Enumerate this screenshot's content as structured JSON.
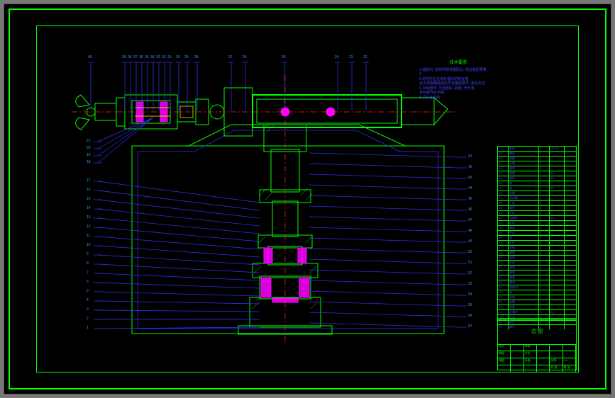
{
  "notes": {
    "title": "技术要求",
    "lines": [
      "1.装配时, 请参照部件图配合, 保证装配质量",
      "2.",
      "3.零件应经过热处理及防锈处理",
      "  加工表面粗糙度应符合图纸要求, 各处光洁",
      "4. 转动部件 灵活自如, 紧固, 无卡滞",
      "  手动操作应平稳,",
      "5.试车合格后",
      ""
    ]
  },
  "top_balloons": [
    "40",
    "39",
    "38",
    "37",
    "36",
    "35",
    "34",
    "33",
    "32",
    "31",
    "30",
    "29",
    "28",
    "",
    "27",
    "26",
    "",
    "25",
    "",
    "24",
    "23",
    "22"
  ],
  "left_balloons_upper": [
    "21",
    "20",
    "19",
    "18"
  ],
  "left_balloons_lower": [
    "17",
    "16",
    "15",
    "14",
    "13",
    "12",
    "11",
    "10",
    "9",
    "8",
    "7",
    "6",
    "5",
    "4",
    "3",
    "2",
    "1"
  ],
  "right_balloons": [
    "41",
    "42",
    "43",
    "44",
    "45",
    "46",
    "47",
    "48",
    "49",
    "50",
    "51",
    "52",
    "53",
    "54",
    "55",
    "56",
    "57"
  ],
  "bom": [
    {
      "no": "57",
      "name": "底座",
      "qty": "1",
      "mat": "HT200",
      "note": ""
    },
    {
      "no": "56",
      "name": "螺栓",
      "qty": "4",
      "mat": "",
      "note": ""
    },
    {
      "no": "55",
      "name": "垫圈",
      "qty": "4",
      "mat": "",
      "note": ""
    },
    {
      "no": "54",
      "name": "下盖",
      "qty": "1",
      "mat": "",
      "note": ""
    },
    {
      "no": "53",
      "name": "轴承",
      "qty": "2",
      "mat": "",
      "note": ""
    },
    {
      "no": "52",
      "name": "套筒",
      "qty": "1",
      "mat": "45",
      "note": ""
    },
    {
      "no": "51",
      "name": "齿轮",
      "qty": "1",
      "mat": "45",
      "note": ""
    },
    {
      "no": "50",
      "name": "键",
      "qty": "1",
      "mat": "",
      "note": ""
    },
    {
      "no": "49",
      "name": "轴",
      "qty": "1",
      "mat": "45",
      "note": ""
    },
    {
      "no": "48",
      "name": "挡圈",
      "qty": "1",
      "mat": "",
      "note": ""
    },
    {
      "no": "47",
      "name": "密封圈",
      "qty": "2",
      "mat": "",
      "note": ""
    },
    {
      "no": "46",
      "name": "上盖",
      "qty": "1",
      "mat": "",
      "note": ""
    },
    {
      "no": "45",
      "name": "螺钉",
      "qty": "6",
      "mat": "",
      "note": ""
    },
    {
      "no": "44",
      "name": "立柱",
      "qty": "1",
      "mat": "",
      "note": ""
    },
    {
      "no": "43",
      "name": "活塞杆",
      "qty": "1",
      "mat": "45",
      "note": ""
    },
    {
      "no": "42",
      "name": "缸体",
      "qty": "1",
      "mat": "",
      "note": ""
    },
    {
      "no": "41",
      "name": "端盖",
      "qty": "1",
      "mat": "",
      "note": ""
    },
    {
      "no": "40",
      "name": "手爪",
      "qty": "1",
      "mat": "",
      "note": ""
    },
    {
      "no": "39",
      "name": "销",
      "qty": "2",
      "mat": "",
      "note": ""
    },
    {
      "no": "38",
      "name": "连杆",
      "qty": "2",
      "mat": "",
      "note": ""
    },
    {
      "no": "37",
      "name": "夹板",
      "qty": "2",
      "mat": "",
      "note": ""
    },
    {
      "no": "36",
      "name": "弹簧",
      "qty": "1",
      "mat": "",
      "note": ""
    },
    {
      "no": "35",
      "name": "推杆",
      "qty": "1",
      "mat": "",
      "note": ""
    },
    {
      "no": "34",
      "name": "外壳",
      "qty": "1",
      "mat": "",
      "note": ""
    },
    {
      "no": "33",
      "name": "轴承",
      "qty": "2",
      "mat": "",
      "note": ""
    },
    {
      "no": "32",
      "name": "隔套",
      "qty": "1",
      "mat": "",
      "note": ""
    },
    {
      "no": "31",
      "name": "端盖",
      "qty": "1",
      "mat": "",
      "note": ""
    },
    {
      "no": "30",
      "name": "螺母",
      "qty": "1",
      "mat": "",
      "note": ""
    },
    {
      "no": "29",
      "name": "联轴节",
      "qty": "1",
      "mat": "",
      "note": ""
    },
    {
      "no": "28",
      "name": "销",
      "qty": "1",
      "mat": "",
      "note": ""
    },
    {
      "no": "27",
      "name": "支架",
      "qty": "1",
      "mat": "",
      "note": ""
    },
    {
      "no": "26",
      "name": "缸筒",
      "qty": "1",
      "mat": "",
      "note": ""
    },
    {
      "no": "25",
      "name": "活塞",
      "qty": "1",
      "mat": "",
      "note": ""
    },
    {
      "no": "24",
      "name": "活塞杆",
      "qty": "1",
      "mat": "45",
      "note": ""
    },
    {
      "no": "23",
      "name": "后盖",
      "qty": "1",
      "mat": "",
      "note": ""
    },
    {
      "no": "22",
      "name": "接头",
      "qty": "1",
      "mat": "",
      "note": ""
    },
    {
      "no": "21",
      "name": "螺钉",
      "qty": "4",
      "mat": "",
      "note": ""
    }
  ],
  "titleblock": {
    "title": "总 图",
    "rows": [
      [
        "设计",
        "",
        "审核",
        "",
        "",
        ""
      ],
      [
        "制图",
        "",
        "工艺",
        "",
        "",
        ""
      ],
      [
        "描图",
        "",
        "标准",
        "",
        "比例",
        "1:2"
      ],
      [
        "",
        "",
        "",
        "",
        "共 张",
        "第 张"
      ]
    ],
    "school": "",
    "drawing_no": ""
  }
}
